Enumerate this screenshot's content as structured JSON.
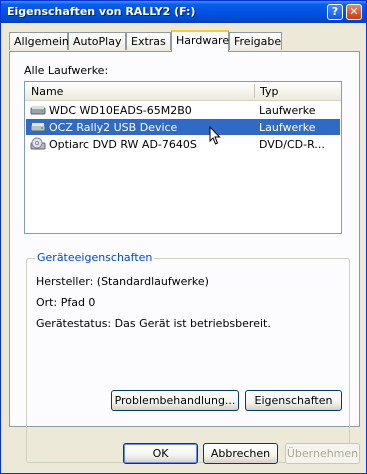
{
  "window": {
    "title": "Eigenschaften von RALLY2 (F:)"
  },
  "titlebar_buttons": {
    "help": "?",
    "close": "✕"
  },
  "tabs": [
    {
      "label": "Allgemein",
      "active": false
    },
    {
      "label": "AutoPlay",
      "active": false
    },
    {
      "label": "Extras",
      "active": false
    },
    {
      "label": "Hardware",
      "active": true
    },
    {
      "label": "Freigabe",
      "active": false
    }
  ],
  "drives_label": "Alle Laufwerke:",
  "list": {
    "columns": [
      "Name",
      "Typ"
    ],
    "rows": [
      {
        "name": "WDC WD10EADS-65M2B0",
        "type": "Laufwerke",
        "icon": "hard-drive-icon",
        "selected": false
      },
      {
        "name": "OCZ Rally2 USB Device",
        "type": "Laufwerke",
        "icon": "usb-drive-icon",
        "selected": true
      },
      {
        "name": "Optiarc DVD RW AD-7640S",
        "type": "DVD/CD-R...",
        "icon": "dvd-drive-icon",
        "selected": false
      }
    ]
  },
  "properties": {
    "title": "Geräteeigenschaften",
    "manufacturer": "Hersteller: (Standardlaufwerke)",
    "location": "Ort: Pfad 0",
    "status": "Gerätestatus: Das Gerät ist betriebsbereit."
  },
  "buttons": {
    "troubleshoot": "Problembehandlung...",
    "properties": "Eigenschaften",
    "ok": "OK",
    "cancel": "Abbrechen",
    "apply": "Übernehmen"
  },
  "colors": {
    "selection": "#316ac5",
    "titlebar": "#0054e3",
    "group_title": "#0046d5"
  }
}
